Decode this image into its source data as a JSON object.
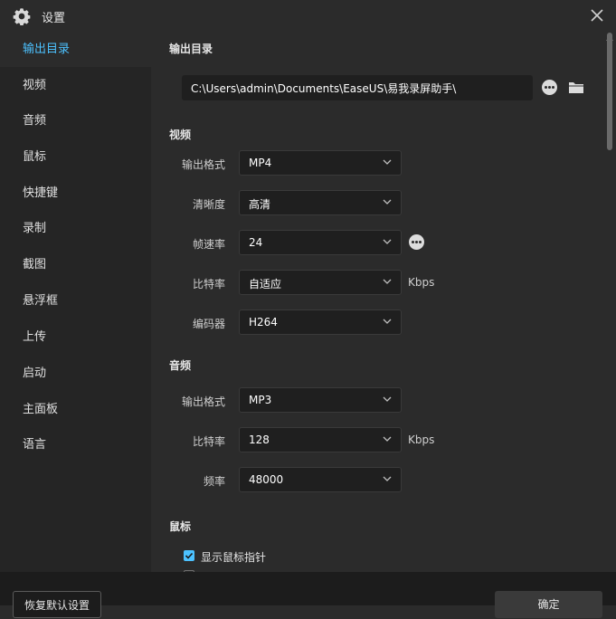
{
  "window": {
    "title": "设置"
  },
  "sidebar": {
    "items": [
      {
        "label": "输出目录"
      },
      {
        "label": "视频"
      },
      {
        "label": "音频"
      },
      {
        "label": "鼠标"
      },
      {
        "label": "快捷键"
      },
      {
        "label": "录制"
      },
      {
        "label": "截图"
      },
      {
        "label": "悬浮框"
      },
      {
        "label": "上传"
      },
      {
        "label": "启动"
      },
      {
        "label": "主面板"
      },
      {
        "label": "语言"
      }
    ]
  },
  "output": {
    "heading": "输出目录",
    "path": "C:\\Users\\admin\\Documents\\EaseUS\\易我录屏助手\\"
  },
  "video": {
    "heading": "视频",
    "format_label": "输出格式",
    "format_value": "MP4",
    "quality_label": "清晰度",
    "quality_value": "高清",
    "fps_label": "帧速率",
    "fps_value": "24",
    "bitrate_label": "比特率",
    "bitrate_value": "自适应",
    "bitrate_unit": "Kbps",
    "encoder_label": "编码器",
    "encoder_value": "H264"
  },
  "audio": {
    "heading": "音频",
    "format_label": "输出格式",
    "format_value": "MP3",
    "bitrate_label": "比特率",
    "bitrate_value": "128",
    "bitrate_unit": "Kbps",
    "rate_label": "频率",
    "rate_value": "48000"
  },
  "mouse": {
    "heading": "鼠标",
    "show_pointer_label": "显示鼠标指针",
    "show_pointer_checked": true,
    "second_option_checked": false
  },
  "footer": {
    "reset_label": "恢复默认设置",
    "ok_label": "确定"
  },
  "colors": {
    "accent": "#4cc2ff",
    "background": "#2b2b2b",
    "sidebar": "#252525",
    "field": "#1f1f1f"
  }
}
